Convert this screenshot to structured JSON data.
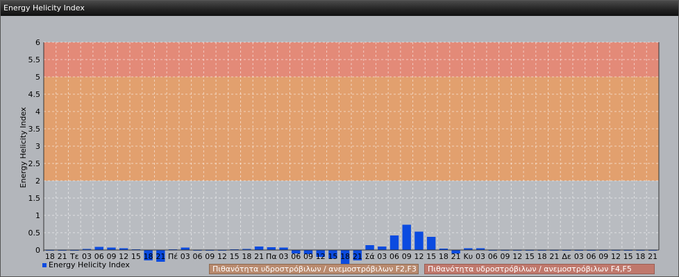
{
  "window": {
    "title": "Energy Helicity Index"
  },
  "legend": {
    "series_label": "Energy Helicity Index",
    "zones": [
      {
        "label": "Πιθανότητα υδροστρόβιλων / ανεμοστρόβιλων F2,F3",
        "color": "#b98a6e",
        "border": "#8c6a52"
      },
      {
        "label": "Πιθανότητα υδροστρόβιλων / ανεμοστρόβιλων F4,F5",
        "color": "#c0786c",
        "border": "#9a5e54"
      }
    ]
  },
  "chart_data": {
    "type": "bar",
    "ylabel": "Energy Helicity Index",
    "ylim": [
      0,
      6
    ],
    "yticks": [
      0,
      0.5,
      1,
      1.5,
      2,
      2.5,
      3,
      3.5,
      4,
      4.5,
      5,
      5.5,
      6
    ],
    "bands": [
      {
        "from": 2,
        "to": 5,
        "color": "#e2a06e"
      },
      {
        "from": 5,
        "to": 6,
        "color": "#e38a78"
      }
    ],
    "series_color": "#0b4be0",
    "categories": [
      "18",
      "21",
      "Τε",
      "03",
      "06",
      "09",
      "12",
      "15",
      "18",
      "21",
      "Πέ",
      "03",
      "06",
      "09",
      "12",
      "15",
      "18",
      "21",
      "Πα",
      "03",
      "06",
      "09",
      "12",
      "15",
      "18",
      "21",
      "Σά",
      "03",
      "06",
      "09",
      "12",
      "15",
      "18",
      "21",
      "Κυ",
      "03",
      "06",
      "09",
      "12",
      "15",
      "18",
      "21",
      "Δε",
      "03",
      "06",
      "09",
      "12",
      "15",
      "18",
      "21"
    ],
    "values": [
      0.01,
      0.01,
      0.01,
      0.03,
      0.09,
      0.07,
      0.05,
      0.02,
      -0.3,
      -0.34,
      0.02,
      0.07,
      0.01,
      0.01,
      0.01,
      0.02,
      0.03,
      0.1,
      0.08,
      0.07,
      -0.1,
      -0.12,
      -0.2,
      -0.25,
      -0.42,
      -0.3,
      0.14,
      0.1,
      0.42,
      0.73,
      0.53,
      0.38,
      0.04,
      -0.1,
      0.05,
      0.05,
      0.01,
      0.01,
      0.01,
      0.01,
      0.01,
      0.01,
      0.01,
      0.01,
      0.01,
      0.01,
      0.01,
      0.01,
      0.01,
      0.01
    ]
  }
}
